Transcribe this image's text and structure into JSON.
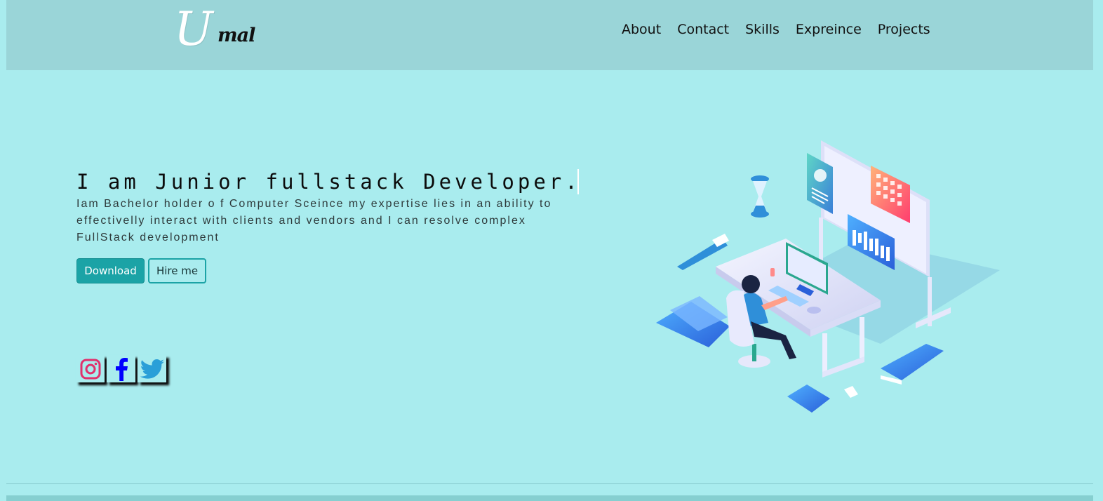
{
  "logo": {
    "initial": "U",
    "rest": "mal"
  },
  "nav": {
    "links": [
      "About",
      "Contact",
      "Skills",
      "Expreince",
      "Projects"
    ]
  },
  "hero": {
    "title": "I am Junior fullstack Developer.",
    "description": "Iam Bachelor holder o f Computer Sceince my expertise lies in an ability to effectivelly interact with clients and vendors and I can resolve complex FullStack development",
    "download_label": "Download",
    "hire_label": "Hire me"
  },
  "social": {
    "icons": [
      "instagram-icon",
      "facebook-icon",
      "twitter-icon"
    ]
  },
  "colors": {
    "background": "#a9ecee",
    "navbar": "#9ad5d8",
    "accent": "#1ba3a6",
    "instagram": "#e1306c",
    "facebook": "#0000ff",
    "twitter": "#1da1f2"
  }
}
